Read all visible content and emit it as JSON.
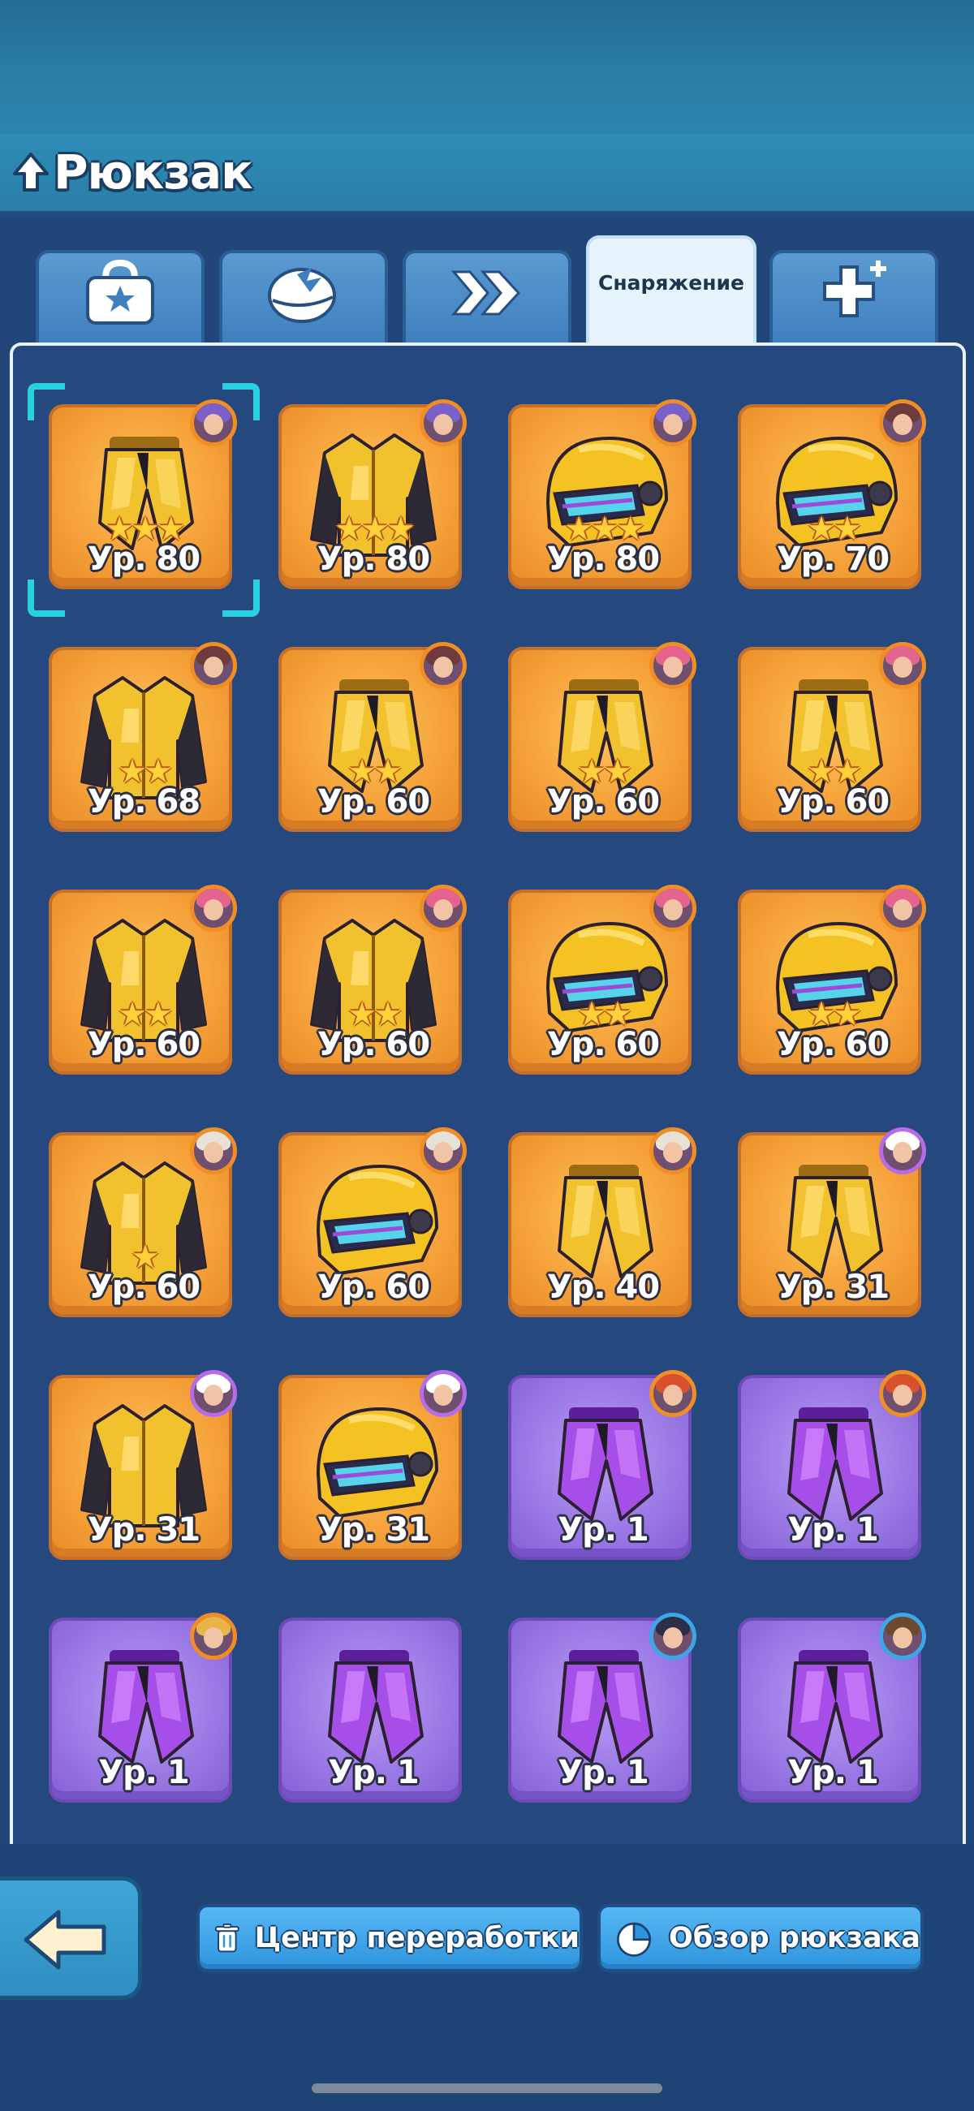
{
  "header": {
    "title": "Рюкзак",
    "nav_icon": "tree-up-arrow-icon"
  },
  "tabs": [
    {
      "icon": "bag-star-icon",
      "label": ""
    },
    {
      "icon": "helmet-wing-icon",
      "label": ""
    },
    {
      "icon": "double-chevron-icon",
      "label": ""
    },
    {
      "icon": "",
      "label": "Снаряжение"
    },
    {
      "icon": "puzzle-plus-icon",
      "label": ""
    }
  ],
  "active_tab": 3,
  "items": [
    {
      "type": "pants",
      "rarity": "gold",
      "stars": 3,
      "level": "Ур. 80",
      "avatar": "purple-haired-hero",
      "selected": true
    },
    {
      "type": "jacket",
      "rarity": "gold",
      "stars": 3,
      "level": "Ур. 80",
      "avatar": "purple-haired-hero"
    },
    {
      "type": "helmet",
      "rarity": "gold",
      "stars": 3,
      "level": "Ур. 80",
      "avatar": "purple-haired-hero"
    },
    {
      "type": "helmet",
      "rarity": "gold",
      "stars": 2,
      "level": "Ур. 70",
      "avatar": "hooded-hero"
    },
    {
      "type": "jacket",
      "rarity": "gold",
      "stars": 2,
      "level": "Ур. 68",
      "avatar": "hooded-hero"
    },
    {
      "type": "pants",
      "rarity": "gold",
      "stars": 2,
      "level": "Ур. 60",
      "avatar": "hooded-hero"
    },
    {
      "type": "pants",
      "rarity": "gold",
      "stars": 2,
      "level": "Ур. 60",
      "avatar": "pink-haired-hero"
    },
    {
      "type": "pants",
      "rarity": "gold",
      "stars": 2,
      "level": "Ур. 60",
      "avatar": "pink-haired-hero"
    },
    {
      "type": "jacket",
      "rarity": "gold",
      "stars": 2,
      "level": "Ур. 60",
      "avatar": "pink-haired-hero"
    },
    {
      "type": "jacket",
      "rarity": "gold",
      "stars": 2,
      "level": "Ур. 60",
      "avatar": "pink-haired-hero"
    },
    {
      "type": "helmet",
      "rarity": "gold",
      "stars": 2,
      "level": "Ур. 60",
      "avatar": "pink-haired-hero"
    },
    {
      "type": "helmet",
      "rarity": "gold",
      "stars": 2,
      "level": "Ур. 60",
      "avatar": "pink-haired-hero"
    },
    {
      "type": "jacket",
      "rarity": "gold",
      "stars": 1,
      "level": "Ур. 60",
      "avatar": "bearded-cap-hero"
    },
    {
      "type": "helmet",
      "rarity": "gold",
      "stars": 0,
      "level": "Ур. 60",
      "avatar": "bearded-cap-hero"
    },
    {
      "type": "pants",
      "rarity": "gold",
      "stars": 0,
      "level": "Ур. 40",
      "avatar": "bearded-cap-hero"
    },
    {
      "type": "pants",
      "rarity": "gold",
      "stars": 0,
      "level": "Ур. 31",
      "avatar": "chef-hero"
    },
    {
      "type": "jacket",
      "rarity": "gold",
      "stars": 0,
      "level": "Ур. 31",
      "avatar": "chef-hero"
    },
    {
      "type": "helmet",
      "rarity": "gold",
      "stars": 0,
      "level": "Ур. 31",
      "avatar": "chef-hero"
    },
    {
      "type": "pants",
      "rarity": "purple",
      "stars": 0,
      "level": "Ур. 1",
      "avatar": "red-haired-hero"
    },
    {
      "type": "pants",
      "rarity": "purple",
      "stars": 0,
      "level": "Ур. 1",
      "avatar": "red-haired-hero"
    },
    {
      "type": "pants",
      "rarity": "purple",
      "stars": 0,
      "level": "Ур. 1",
      "avatar": "blonde-hero"
    },
    {
      "type": "pants",
      "rarity": "purple",
      "stars": 0,
      "level": "Ур. 1",
      "avatar": ""
    },
    {
      "type": "pants",
      "rarity": "purple",
      "stars": 0,
      "level": "Ур. 1",
      "avatar": "dark-haired-hero"
    },
    {
      "type": "pants",
      "rarity": "purple",
      "stars": 0,
      "level": "Ур. 1",
      "avatar": "brown-haired-hero"
    }
  ],
  "footer": {
    "back_icon": "arrow-left-icon",
    "recycle": {
      "icon": "trash-icon",
      "label": "Центр переработки"
    },
    "overview": {
      "icon": "pie-chart-icon",
      "label": "Обзор рюкзака"
    }
  },
  "colors": {
    "background": "#23467a",
    "gold_card": "#f6a23a",
    "purple_card": "#9c7ae6",
    "selection": "#2ad0e0",
    "button_blue": "#3a9fe4"
  }
}
